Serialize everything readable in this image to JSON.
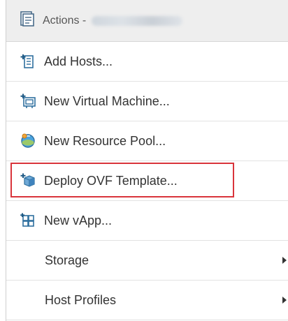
{
  "header": {
    "title": "Actions -",
    "icon": "actions-icon"
  },
  "menu": {
    "items": [
      {
        "label": "Add Hosts...",
        "icon": "add-hosts-icon"
      },
      {
        "label": "New Virtual Machine...",
        "icon": "new-vm-icon"
      },
      {
        "label": "New Resource Pool...",
        "icon": "resource-pool-icon"
      },
      {
        "label": "Deploy OVF Template...",
        "icon": "deploy-ovf-icon",
        "highlighted": true
      },
      {
        "label": "New vApp...",
        "icon": "vapp-icon"
      },
      {
        "label": "Storage",
        "submenu": true
      },
      {
        "label": "Host Profiles",
        "submenu": true
      }
    ]
  },
  "colors": {
    "highlight_border": "#d9343b",
    "header_bg": "#eeeeee",
    "icon_blue": "#2f6f9e",
    "text": "#333333"
  }
}
